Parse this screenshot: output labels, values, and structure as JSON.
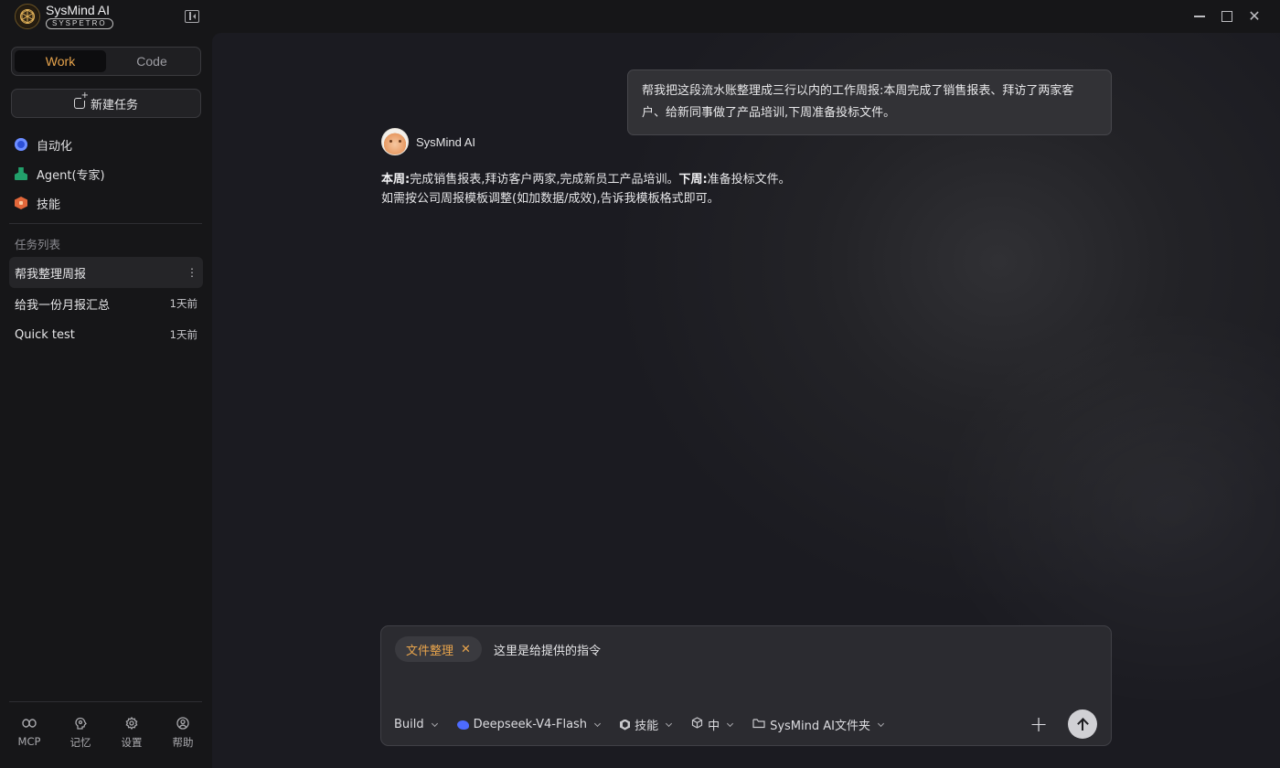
{
  "brand": {
    "name": "SysMind AI",
    "subtitle": "SYSPETRO"
  },
  "mode_switch": {
    "work_label": "Work",
    "code_label": "Code",
    "active": "Work"
  },
  "new_task_label": "新建任务",
  "nav": {
    "items": [
      {
        "label": "自动化",
        "icon": "automation-icon"
      },
      {
        "label": "Agent(专家)",
        "icon": "agent-icon"
      },
      {
        "label": "技能",
        "icon": "skill-icon"
      }
    ]
  },
  "task_section_title": "任务列表",
  "tasks": [
    {
      "title": "帮我整理周报",
      "time": "",
      "active": true
    },
    {
      "title": "给我一份月报汇总",
      "time": "1天前",
      "active": false
    },
    {
      "title": "Quick test",
      "time": "1天前",
      "active": false
    }
  ],
  "footer": {
    "items": [
      {
        "label": "MCP",
        "icon": "link-icon"
      },
      {
        "label": "记忆",
        "icon": "memory-icon"
      },
      {
        "label": "设置",
        "icon": "gear-icon"
      },
      {
        "label": "帮助",
        "icon": "user-circle-icon"
      }
    ]
  },
  "conversation": {
    "user_message": "帮我把这段流水账整理成三行以内的工作周报:本周完成了销售报表、拜访了两家客户、给新同事做了产品培训,下周准备投标文件。",
    "assistant_name": "SysMind AI",
    "assistant_line1_label1": "本周:",
    "assistant_line1_text1": "完成销售报表,拜访客户两家,完成新员工产品培训。",
    "assistant_line1_label2": "下周:",
    "assistant_line1_text2": "准备投标文件。",
    "assistant_line2": "如需按公司周报模板调整(如加数据/成效),告诉我模板格式即可。"
  },
  "composer": {
    "chip_label": "文件整理",
    "prompt_text": "这里是给提供的指令",
    "toolbar": {
      "build_label": "Build",
      "model_label": "Deepseek-V4-Flash",
      "skill_label": "技能",
      "level_label": "中",
      "folder_label": "SysMind AI文件夹"
    }
  },
  "colors": {
    "accent": "#e8a44c",
    "sidebar_bg": "#161618",
    "main_bg": "#1b1b21",
    "deepseek_blue": "#4d6bfe"
  }
}
